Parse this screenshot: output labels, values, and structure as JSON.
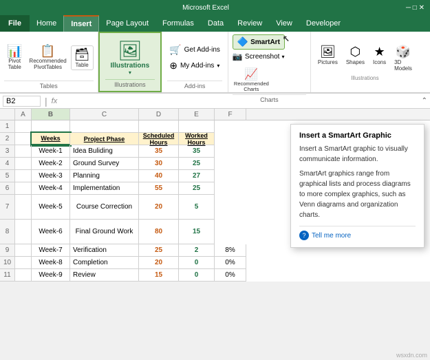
{
  "titleBar": {
    "text": "Microsoft Excel"
  },
  "menuBar": {
    "fileLabel": "File",
    "tabs": [
      "Home",
      "Insert",
      "Page Layout",
      "Formulas",
      "Data",
      "Review",
      "View",
      "Developer"
    ]
  },
  "activeTab": "Insert",
  "ribbonGroups": {
    "tables": {
      "label": "Tables",
      "buttons": [
        "PivotTable",
        "Recommended PivotTables",
        "Table"
      ]
    },
    "illustrations": {
      "label": "Illustrations",
      "active": true,
      "buttons": [
        "Pictures",
        "Shapes",
        "Icons",
        "3D Models"
      ]
    },
    "addins": {
      "label": "Add-ins",
      "items": [
        "Get Add-ins",
        "My Add-ins"
      ]
    },
    "charts": {
      "label": "Charts",
      "buttons": [
        "Recommended Charts"
      ]
    }
  },
  "smartart": {
    "label": "SmartArt",
    "subLabel": "Screenshot"
  },
  "formulaBar": {
    "nameBox": "B2",
    "fx": "fx"
  },
  "colHeaders": [
    "",
    "A",
    "B",
    "C",
    "D",
    "E"
  ],
  "rowNums": [
    "1",
    "2",
    "3",
    "4",
    "5",
    "6",
    "7",
    "8",
    "9",
    "10",
    "11"
  ],
  "tableHeaders": {
    "weeks": "Weeks",
    "phase": "Project Phase",
    "scheduled": "Scheduled Hours",
    "worked": "Worked Hours"
  },
  "tableRows": [
    {
      "week": "Week-1",
      "phase": "Idea Buliding",
      "scheduled": "35",
      "worked": "35",
      "extra": ""
    },
    {
      "week": "Week-2",
      "phase": "Ground Survey",
      "scheduled": "30",
      "worked": "25",
      "extra": ""
    },
    {
      "week": "Week-3",
      "phase": "Planning",
      "scheduled": "40",
      "worked": "27",
      "extra": ""
    },
    {
      "week": "Week-4",
      "phase": "Implementation",
      "scheduled": "55",
      "worked": "25",
      "extra": ""
    },
    {
      "week": "Week-5",
      "phase": "Course Correction",
      "scheduled": "20",
      "worked": "5",
      "extra": "",
      "mergePhase": true
    },
    {
      "week": "Week-6",
      "phase": "Final Ground Work",
      "scheduled": "80",
      "worked": "15",
      "extra": "",
      "mergePhase": true
    },
    {
      "week": "Week-7",
      "phase": "Verification",
      "scheduled": "25",
      "worked": "2",
      "extra": "8%"
    },
    {
      "week": "Week-8",
      "phase": "Completion",
      "scheduled": "20",
      "worked": "0",
      "extra": "0%"
    },
    {
      "week": "Week-9",
      "phase": "Review",
      "scheduled": "15",
      "worked": "0",
      "extra": "0%"
    }
  ],
  "tooltip": {
    "title": "Insert a SmartArt Graphic",
    "line1": "Insert a SmartArt graphic to visually communicate information.",
    "line2": "SmartArt graphics range from graphical lists and process diagrams to more complex graphics, such as Venn diagrams and organization charts.",
    "link": "Tell me more"
  },
  "watermark": "wsxdn.com",
  "colWidths": {
    "A": 22,
    "B": 48,
    "C": 100,
    "D": 58,
    "E": 52,
    "F": 46
  }
}
